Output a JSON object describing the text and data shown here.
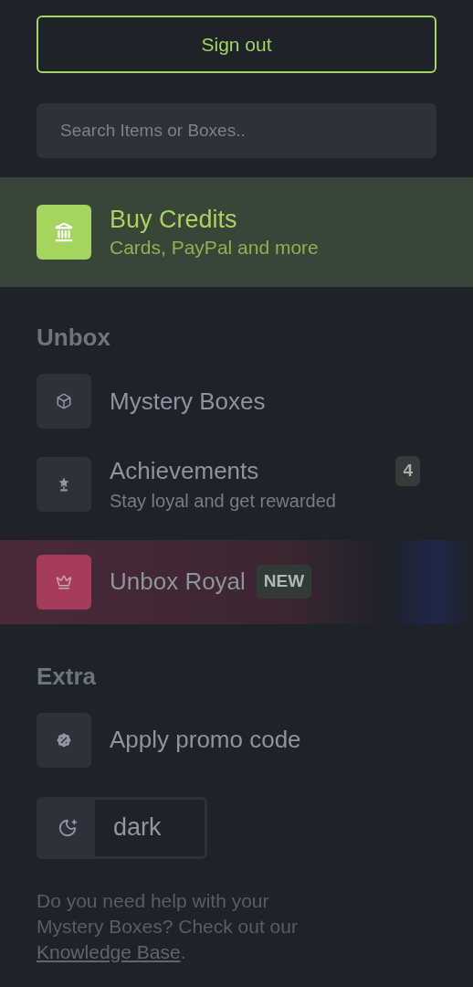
{
  "sign_out": {
    "label": "Sign out"
  },
  "search": {
    "placeholder": "Search Items or Boxes.."
  },
  "buy_credits": {
    "title": "Buy Credits",
    "subtitle": "Cards, PayPal and more"
  },
  "sections": [
    {
      "heading": "Unbox",
      "items": [
        {
          "kind": "box",
          "label": "Mystery Boxes"
        },
        {
          "kind": "trophy",
          "label": "Achievements",
          "subtitle": "Stay loyal and get rewarded",
          "count": "4"
        },
        {
          "kind": "royal",
          "label": "Unbox Royal",
          "badge": "NEW"
        }
      ]
    },
    {
      "heading": "Extra",
      "items": [
        {
          "kind": "promo",
          "label": "Apply promo code"
        }
      ]
    }
  ],
  "theme_toggle": {
    "label": "dark"
  },
  "help": {
    "text": "Do you need help with your Mystery Boxes? Check out our ",
    "link": "Knowledge Base",
    "end": "."
  }
}
